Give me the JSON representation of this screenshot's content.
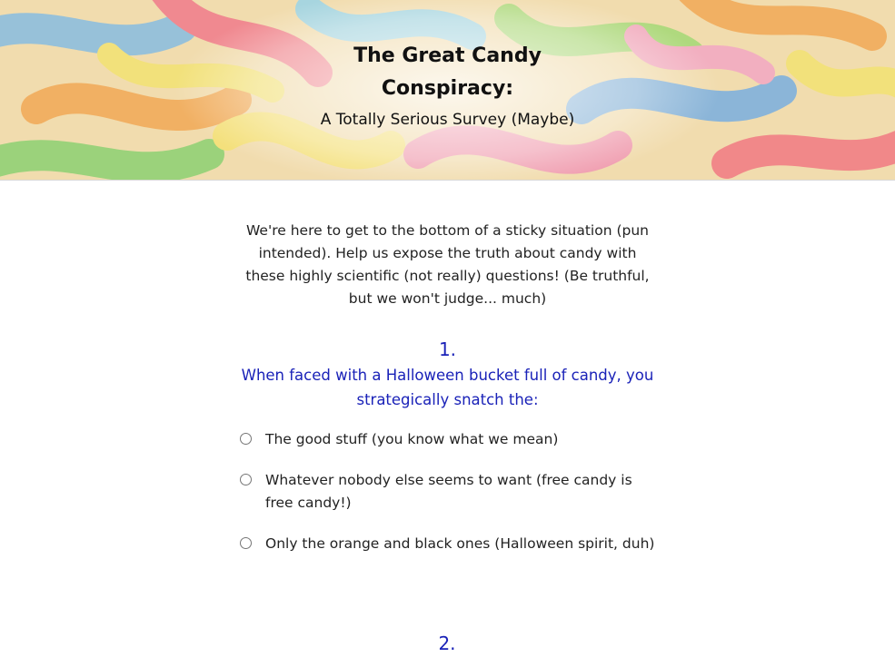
{
  "header": {
    "title": "The Great Candy Conspiracy:",
    "subtitle": "A Totally Serious Survey (Maybe)"
  },
  "intro": {
    "text": "We're here to get to the bottom of a sticky situation (pun intended). Help us expose the truth about candy with these highly scientific (not really) questions! (Be truthful, but we won't judge... much)"
  },
  "questions": [
    {
      "number": "1.",
      "text": "When faced with a Halloween bucket full of candy, you strategically snatch the:",
      "options": [
        {
          "label": "The good stuff (you know what we mean)",
          "selected": false
        },
        {
          "label": "Whatever nobody else seems to want (free candy is free candy!)",
          "selected": false
        },
        {
          "label": "Only the orange and black ones (Halloween spirit, duh)",
          "selected": false
        }
      ]
    },
    {
      "number": "2."
    }
  ],
  "colors": {
    "question_color": "#1a22b8",
    "text_color": "#222222"
  }
}
